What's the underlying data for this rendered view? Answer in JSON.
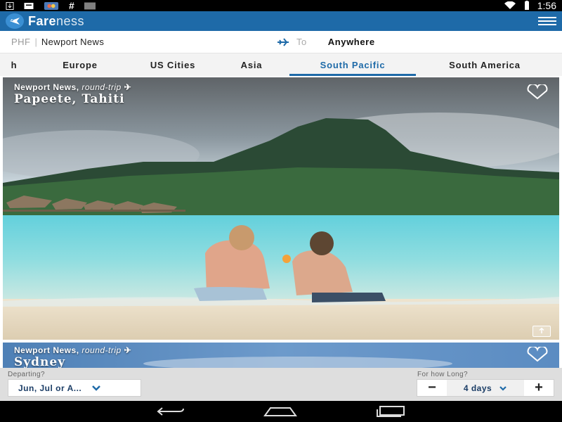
{
  "status": {
    "time": "1:56"
  },
  "app": {
    "brand_bold": "Fare",
    "brand_light": "ness"
  },
  "search": {
    "from_code": "PHF",
    "from_city": "Newport News",
    "to_label": "To",
    "to_value": "Anywhere"
  },
  "tabs": [
    {
      "label": "h"
    },
    {
      "label": "Europe"
    },
    {
      "label": "US Cities"
    },
    {
      "label": "Asia"
    },
    {
      "label": "South Pacific",
      "active": true
    },
    {
      "label": "South America"
    }
  ],
  "cards": [
    {
      "origin": "Newport News",
      "trip": "round-trip",
      "destination": "Papeete, Tahiti"
    },
    {
      "origin": "Newport News",
      "trip": "round-trip",
      "destination": "Sydney"
    }
  ],
  "filter": {
    "departing_label": "Departing?",
    "departing_value": "Jun, Jul or A...",
    "duration_label": "For how Long?",
    "duration_value": "4 days",
    "minus": "−",
    "plus": "+"
  },
  "colors": {
    "primary": "#1e6aa8",
    "active_tab": "#1e6aa8"
  }
}
